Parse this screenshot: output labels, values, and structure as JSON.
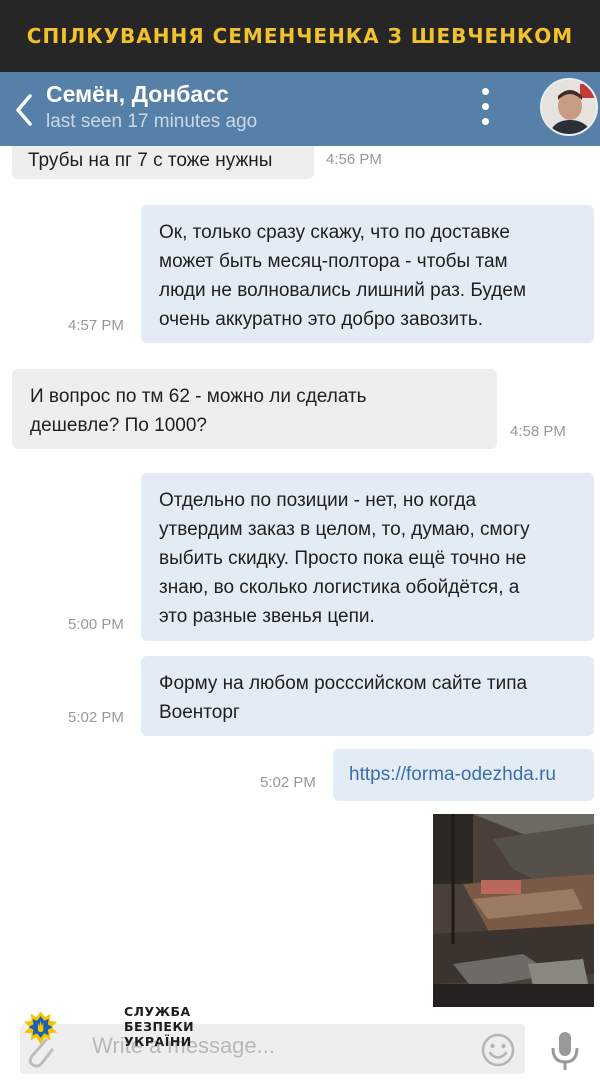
{
  "banner": {
    "text": "СПІЛКУВАННЯ СЕМЕНЧЕНКА З ШЕВЧЕНКОМ",
    "color": "#f2c12e"
  },
  "header": {
    "title": "Семён, Донбасс",
    "status": "last seen 17 minutes ago",
    "back_icon": "chevron-left-icon",
    "menu_icon": "more-vertical-icon"
  },
  "messages": [
    {
      "direction": "incoming",
      "text": "Трубы на пг 7 с тоже нужны",
      "time": "4:56 PM"
    },
    {
      "direction": "outgoing",
      "lines": [
        "Ок, только сразу скажу, что по доставке",
        "может быть месяц-полтора - чтобы там",
        "люди не волновались лишний раз. Будем",
        "очень аккуратно это добро завозить."
      ],
      "time": "4:57 PM"
    },
    {
      "direction": "incoming",
      "lines": [
        "И вопрос по тм 62 - можно ли сделать",
        "дешевле? По 1000?"
      ],
      "time": "4:58 PM"
    },
    {
      "direction": "outgoing",
      "lines": [
        "Отдельно по позиции - нет, но когда",
        "утвердим заказ в целом, то, думаю, смогу",
        "выбить скидку. Просто пока ещё точно не",
        "знаю, во сколько логистика обойдётся, а",
        "это разные звенья цепи."
      ],
      "time": "5:00 PM"
    },
    {
      "direction": "outgoing",
      "lines": [
        "Форму на любом росссийском сайте типа",
        "Военторг"
      ],
      "time": "5:02 PM"
    },
    {
      "direction": "outgoing",
      "text": "https://forma-odezhda.ru",
      "time": "5:02 PM"
    },
    {
      "direction": "outgoing",
      "type": "photo"
    }
  ],
  "composer": {
    "placeholder": "Write a message...",
    "attach_icon": "paperclip-icon",
    "emoji_icon": "smiley-icon",
    "mic_icon": "microphone-icon"
  },
  "watermark": {
    "lines": [
      "СЛУЖБА",
      "БЕЗПЕКИ",
      "УКРАЇНИ"
    ],
    "emblem_icon": "sbu-emblem-icon",
    "color": "#f5c400"
  },
  "colors": {
    "header": "#5680a8",
    "incoming_bubble": "#eeeeef",
    "outgoing_bubble": "#e3ecf5",
    "link": "#3b6fa8"
  }
}
